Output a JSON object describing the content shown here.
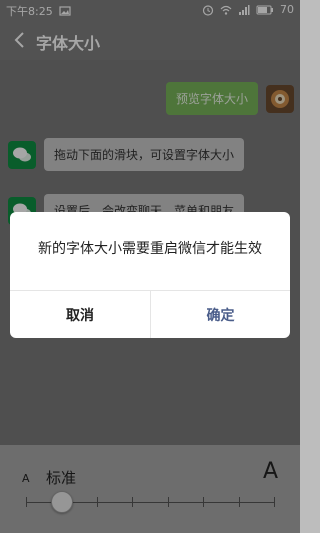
{
  "statusbar": {
    "time": "下午8:25",
    "battery_text": "70"
  },
  "appbar": {
    "title": "字体大小"
  },
  "chat": {
    "preview_text": "预览字体大小",
    "msg1": "拖动下面的滑块，可设置字体大小",
    "msg2_partial": "设置后，会改变聊天、菜单和朋友"
  },
  "font_size": {
    "small_a": "A",
    "current_label": "标准",
    "big_a": "A",
    "level_index": 1,
    "levels": 8
  },
  "dialog": {
    "message": "新的字体大小需要重启微信才能生效",
    "cancel": "取消",
    "confirm": "确定"
  },
  "colors": {
    "bubble_green": "#79b45a",
    "wechat_green": "#0e8f42",
    "confirm_blue": "#4a5d8a"
  }
}
